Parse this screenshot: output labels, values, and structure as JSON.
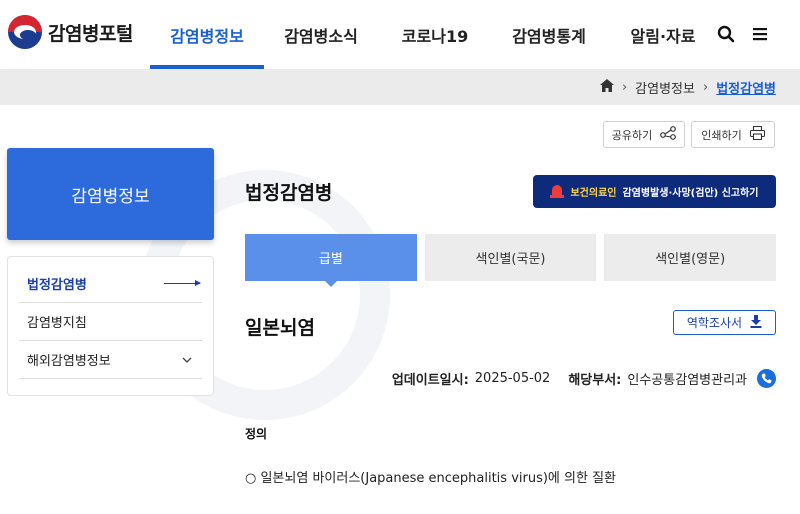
{
  "header": {
    "logo_text": "감염병포털",
    "nav": [
      {
        "label": "감염병정보"
      },
      {
        "label": "감염병소식"
      },
      {
        "label": "코로나19"
      },
      {
        "label": "감염병통계"
      },
      {
        "label": "알림·자료"
      }
    ],
    "active_nav": "감염병정보",
    "accent_color": "#1a5fd0"
  },
  "breadcrumb": {
    "items": [
      "감염병정보",
      "법정감염병"
    ]
  },
  "tools": {
    "share_label": "공유하기",
    "print_label": "인쇄하기"
  },
  "sidebar": {
    "title": "감염병정보",
    "items": [
      {
        "label": "법정감염병"
      },
      {
        "label": "감염병지침"
      },
      {
        "label": "해외감염병정보"
      }
    ]
  },
  "main": {
    "page_title": "법정감염병",
    "report": {
      "highlight": "보건의료인",
      "label": "감염병발생·사망(검안) 신고하기"
    },
    "tabs": [
      {
        "label": "급별"
      },
      {
        "label": "색인별(국문)"
      },
      {
        "label": "색인별(영문)"
      }
    ],
    "disease_title": "일본뇌염",
    "epi_button": "역학조사서",
    "meta": {
      "update_label": "업데이트일시:",
      "update_value": "2025-05-02",
      "dept_label": "해당부서:",
      "dept_value": "인수공통감염병관리과"
    },
    "definition_label": "정의",
    "definition_text": "○ 일본뇌염 바이러스(Japanese encephalitis virus)에 의한 질환"
  }
}
